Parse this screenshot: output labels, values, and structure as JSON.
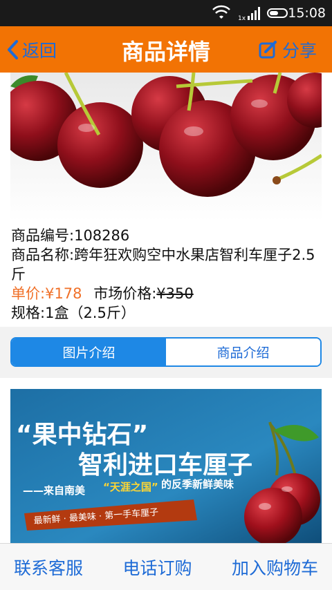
{
  "status_bar": {
    "time": "15:08",
    "signal_label": "1x"
  },
  "header": {
    "back_label": "返回",
    "title": "商品详情",
    "share_label": "分享"
  },
  "product": {
    "code_label": "商品编号:",
    "code": "108286",
    "name_label": "商品名称:",
    "name": "跨年狂欢购空中水果店智利车厘子2.5斤",
    "unit_price_label": "单价:",
    "unit_price": "¥178",
    "market_price_label": "市场价格:",
    "market_price": "¥350",
    "spec_label": "规格:",
    "spec": "1盒（2.5斤）"
  },
  "tabs": [
    {
      "label": "图片介绍",
      "active": true
    },
    {
      "label": "商品介绍",
      "active": false
    }
  ],
  "banner": {
    "headline1": "“果中钻石”",
    "headline2": "智利进口车厘子",
    "subline_prefix": "——来自南美",
    "subline_quote": "“天涯之国”",
    "subline_suffix": "的反季新鲜美味",
    "tagline": "最新鲜 · 最美味 · 第一手车厘子"
  },
  "bottom_bar": {
    "service": "联系客服",
    "phone_order": "电话订购",
    "add_cart": "加入购物车"
  },
  "colors": {
    "header": "#f27304",
    "accent_blue": "#1e6bd6",
    "price_orange": "#f07028",
    "tab_active": "#1e88e5"
  }
}
